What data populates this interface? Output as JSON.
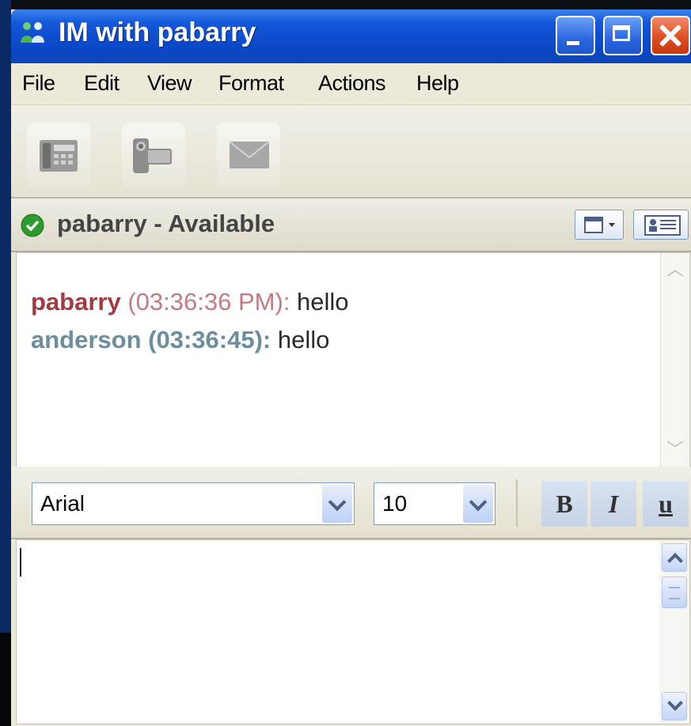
{
  "window": {
    "title": "IM with pabarry"
  },
  "menu": {
    "items": [
      {
        "label": "File"
      },
      {
        "label": "Edit"
      },
      {
        "label": "View"
      },
      {
        "label": "Format"
      },
      {
        "label": "Actions"
      },
      {
        "label": "Help"
      }
    ]
  },
  "toolbar": {
    "icons": [
      "phone-icon",
      "video-camera-icon",
      "mail-icon"
    ]
  },
  "status": {
    "text": "pabarry - Available",
    "icon": "available-check-icon"
  },
  "conversation": {
    "messages": [
      {
        "sender": "pabarry",
        "time": "(03:36:36 PM):",
        "text": "hello"
      },
      {
        "sender": "anderson",
        "time": "(03:36:45):",
        "text": "hello"
      }
    ]
  },
  "format": {
    "font": "Arial",
    "size": "10",
    "bold_label": "B",
    "italic_label": "I",
    "underline_label": "u"
  },
  "colors": {
    "titlebar": "#0a48c8",
    "self_sender": "#a23a42",
    "other_sender": "#6a8ea0"
  }
}
